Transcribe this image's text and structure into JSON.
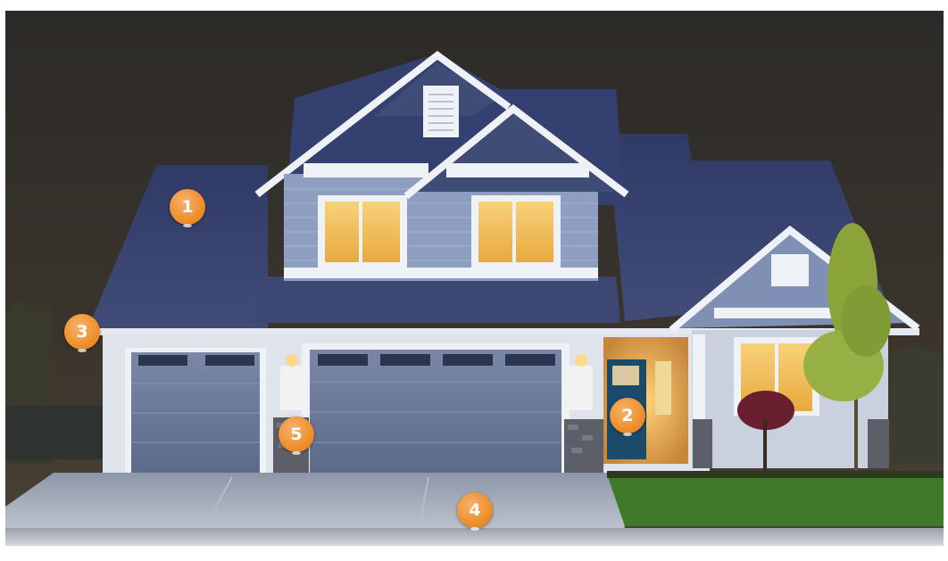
{
  "markers": [
    {
      "id": "roof",
      "label": "1"
    },
    {
      "id": "entry-door",
      "label": "2"
    },
    {
      "id": "gutter",
      "label": "3"
    },
    {
      "id": "driveway",
      "label": "4"
    },
    {
      "id": "stone-veneer",
      "label": "5"
    }
  ],
  "colors": {
    "sky": "#2f2b28",
    "roof": "#3a4570",
    "siding": "#8fa0c0",
    "trim": "#eef1f6",
    "window_glow": "#f2c25a",
    "garage_door": "#6a7796",
    "lawn": "#3f7a2a",
    "driveway": "#a0a7b3",
    "marker": "#ef8f2c",
    "front_door": "#1c4a6a"
  }
}
